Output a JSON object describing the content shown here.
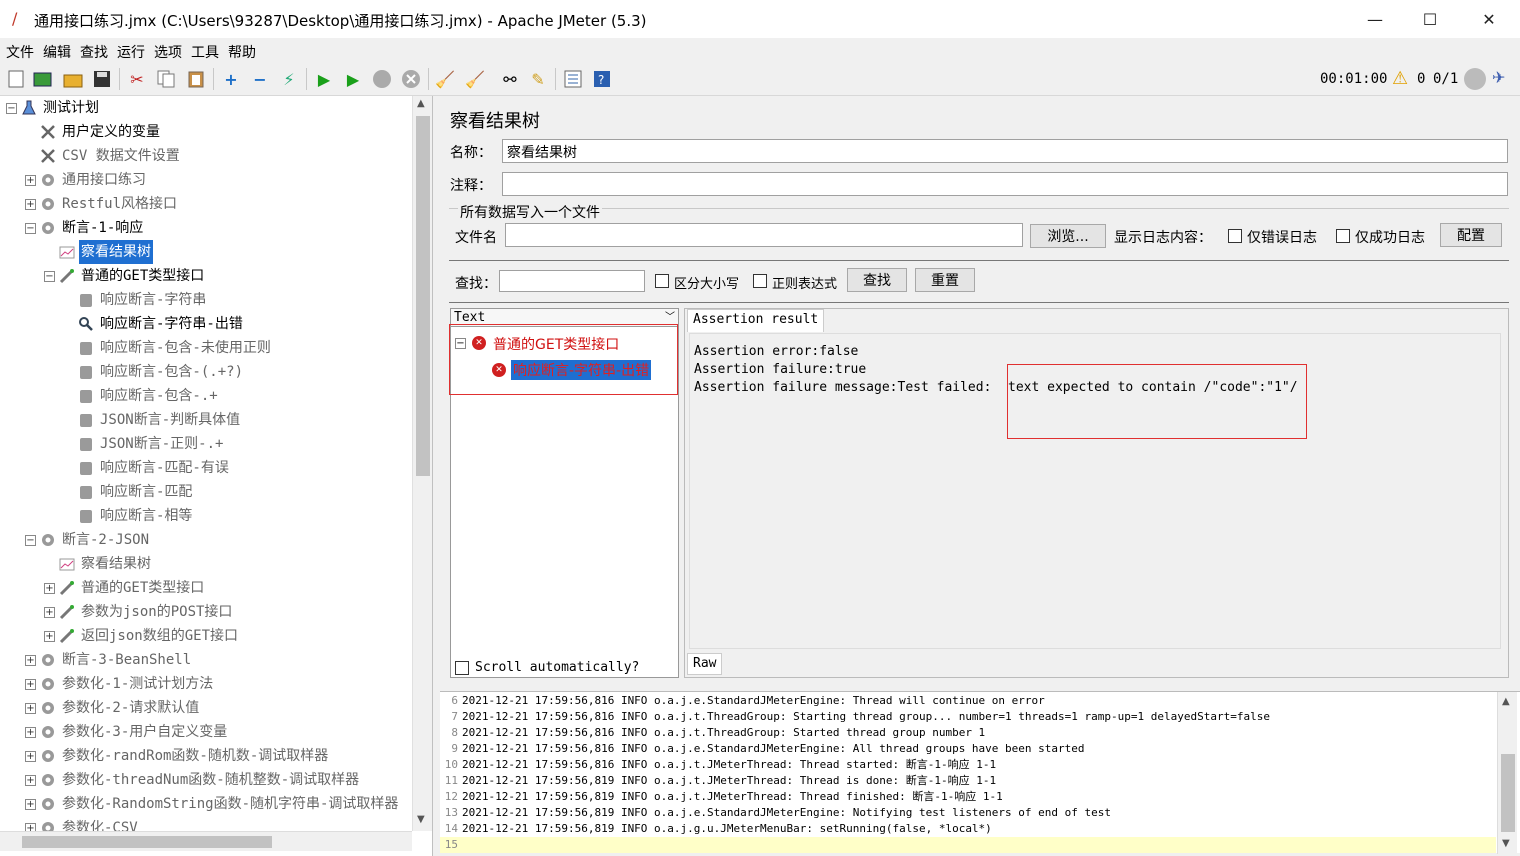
{
  "window": {
    "title": "通用接口练习.jmx (C:\\Users\\93287\\Desktop\\通用接口练习.jmx) - Apache JMeter (5.3)",
    "minimize": "—",
    "maximize": "☐",
    "close": "✕"
  },
  "menu": [
    "文件",
    "编辑",
    "查找",
    "运行",
    "选项",
    "工具",
    "帮助"
  ],
  "toolbar": {
    "timer": "00:01:00",
    "warnings": "0",
    "threads": "0/1"
  },
  "tree": [
    {
      "label": "测试计划",
      "level": 0,
      "exp": "−",
      "icon": "flask-icon",
      "state": "normal"
    },
    {
      "label": "用户定义的变量",
      "level": 1,
      "exp": "",
      "icon": "wrench-icon",
      "state": "normal"
    },
    {
      "label": "CSV 数据文件设置",
      "level": 1,
      "exp": "",
      "icon": "wrench-icon",
      "state": "dis"
    },
    {
      "label": "通用接口练习",
      "level": 1,
      "exp": "+",
      "icon": "gear-icon",
      "state": "dis"
    },
    {
      "label": "Restful风格接口",
      "level": 1,
      "exp": "+",
      "icon": "gear-icon",
      "state": "dis"
    },
    {
      "label": "断言-1-响应",
      "level": 1,
      "exp": "−",
      "icon": "gear-icon",
      "state": "normal"
    },
    {
      "label": "察看结果树",
      "level": 2,
      "exp": "",
      "icon": "chart-icon",
      "state": "sel"
    },
    {
      "label": "普通的GET类型接口",
      "level": 2,
      "exp": "−",
      "icon": "pipette-icon",
      "state": "normal"
    },
    {
      "label": "响应断言-字符串",
      "level": 3,
      "exp": "",
      "icon": "assert-icon",
      "state": "dis"
    },
    {
      "label": "响应断言-字符串-出错",
      "level": 3,
      "exp": "",
      "icon": "magnifier-icon",
      "state": "normal"
    },
    {
      "label": "响应断言-包含-未使用正则",
      "level": 3,
      "exp": "",
      "icon": "assert-icon",
      "state": "dis"
    },
    {
      "label": "响应断言-包含-(.+?)",
      "level": 3,
      "exp": "",
      "icon": "assert-icon",
      "state": "dis"
    },
    {
      "label": "响应断言-包含-.+",
      "level": 3,
      "exp": "",
      "icon": "assert-icon",
      "state": "dis"
    },
    {
      "label": "JSON断言-判断具体值",
      "level": 3,
      "exp": "",
      "icon": "assert-icon",
      "state": "dis"
    },
    {
      "label": "JSON断言-正则-.+",
      "level": 3,
      "exp": "",
      "icon": "assert-icon",
      "state": "dis"
    },
    {
      "label": "响应断言-匹配-有误",
      "level": 3,
      "exp": "",
      "icon": "assert-icon",
      "state": "dis"
    },
    {
      "label": "响应断言-匹配",
      "level": 3,
      "exp": "",
      "icon": "assert-icon",
      "state": "dis"
    },
    {
      "label": "响应断言-相等",
      "level": 3,
      "exp": "",
      "icon": "assert-icon",
      "state": "dis"
    },
    {
      "label": "断言-2-JSON",
      "level": 1,
      "exp": "−",
      "icon": "gear-icon",
      "state": "dis"
    },
    {
      "label": "察看结果树",
      "level": 2,
      "exp": "",
      "icon": "chart-icon",
      "state": "dis"
    },
    {
      "label": "普通的GET类型接口",
      "level": 2,
      "exp": "+",
      "icon": "pipette-icon",
      "state": "dis"
    },
    {
      "label": "参数为json的POST接口",
      "level": 2,
      "exp": "+",
      "icon": "pipette-icon",
      "state": "dis"
    },
    {
      "label": "返回json数组的GET接口",
      "level": 2,
      "exp": "+",
      "icon": "pipette-icon",
      "state": "dis"
    },
    {
      "label": "断言-3-BeanShell",
      "level": 1,
      "exp": "+",
      "icon": "gear-icon",
      "state": "dis"
    },
    {
      "label": "参数化-1-测试计划方法",
      "level": 1,
      "exp": "+",
      "icon": "gear-icon",
      "state": "dis"
    },
    {
      "label": "参数化-2-请求默认值",
      "level": 1,
      "exp": "+",
      "icon": "gear-icon",
      "state": "dis"
    },
    {
      "label": "参数化-3-用户自定义变量",
      "level": 1,
      "exp": "+",
      "icon": "gear-icon",
      "state": "dis"
    },
    {
      "label": "参数化-randRom函数-随机数-调试取样器",
      "level": 1,
      "exp": "+",
      "icon": "gear-icon",
      "state": "dis"
    },
    {
      "label": "参数化-threadNum函数-随机整数-调试取样器",
      "level": 1,
      "exp": "+",
      "icon": "gear-icon",
      "state": "dis"
    },
    {
      "label": "参数化-RandomString函数-随机字符串-调试取样器",
      "level": 1,
      "exp": "+",
      "icon": "gear-icon",
      "state": "dis"
    },
    {
      "label": "参数化-CSV",
      "level": 1,
      "exp": "+",
      "icon": "gear-icon",
      "state": "dis"
    }
  ],
  "panel": {
    "title": "察看结果树",
    "name_label": "名称：",
    "name_value": "察看结果树",
    "comment_label": "注释：",
    "comment_value": "",
    "file_section": "所有数据写入一个文件",
    "file_label": "文件名",
    "file_value": "",
    "browse": "浏览...",
    "log_label": "显示日志内容：",
    "errors_only": "仅错误日志",
    "success_only": "仅成功日志",
    "config": "配置",
    "search_label": "查找：",
    "search_value": "",
    "case_sensitive": "区分大小写",
    "regex": "正则表达式",
    "search_btn": "查找",
    "reset_btn": "重置",
    "renderer": "Text",
    "result_parent": "普通的GET类型接口",
    "result_child": "响应断言-字符串-出错",
    "scroll_auto": "Scroll automatically?",
    "tab_assertion": "Assertion result",
    "tab_raw": "Raw",
    "assert_lines": [
      "Assertion error:false",
      "Assertion failure:true",
      "Assertion failure message:Test failed: "
    ],
    "assert_msg": "text expected to contain /\"code\":\"1\"/"
  },
  "log": [
    {
      "n": "6",
      "t": "2021-12-21 17:59:56,816 INFO o.a.j.e.StandardJMeterEngine: Thread will continue on error"
    },
    {
      "n": "7",
      "t": "2021-12-21 17:59:56,816 INFO o.a.j.t.ThreadGroup: Starting thread group... number=1 threads=1 ramp-up=1 delayedStart=false"
    },
    {
      "n": "8",
      "t": "2021-12-21 17:59:56,816 INFO o.a.j.t.ThreadGroup: Started thread group number 1"
    },
    {
      "n": "9",
      "t": "2021-12-21 17:59:56,816 INFO o.a.j.e.StandardJMeterEngine: All thread groups have been started"
    },
    {
      "n": "10",
      "t": "2021-12-21 17:59:56,816 INFO o.a.j.t.JMeterThread: Thread started: 断言-1-响应 1-1"
    },
    {
      "n": "11",
      "t": "2021-12-21 17:59:56,819 INFO o.a.j.t.JMeterThread: Thread is done: 断言-1-响应 1-1"
    },
    {
      "n": "12",
      "t": "2021-12-21 17:59:56,819 INFO o.a.j.t.JMeterThread: Thread finished: 断言-1-响应 1-1"
    },
    {
      "n": "13",
      "t": "2021-12-21 17:59:56,819 INFO o.a.j.e.StandardJMeterEngine: Notifying test listeners of end of test"
    },
    {
      "n": "14",
      "t": "2021-12-21 17:59:56,819 INFO o.a.j.g.u.JMeterMenuBar: setRunning(false, *local*)"
    },
    {
      "n": "15",
      "t": ""
    }
  ]
}
